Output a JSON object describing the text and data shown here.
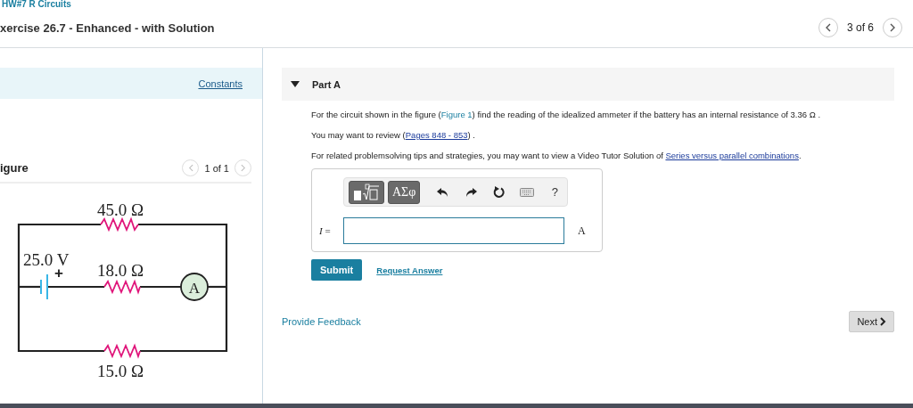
{
  "breadcrumb": "HW#7 R Circuits",
  "title": "xercise 26.7 - Enhanced - with Solution",
  "pager": "3 of 6",
  "constants_link": "Constants",
  "figure": {
    "heading": "igure",
    "pager": "1 of 1",
    "circuit": {
      "top_resistor": "45.0 Ω",
      "battery": "25.0 V",
      "battery_sign": "+",
      "middle_resistor": "18.0 Ω",
      "meter": "A",
      "bottom_resistor": "15.0 Ω"
    }
  },
  "part": {
    "title": "Part A",
    "expanded": true,
    "paragraphs": [
      [
        {
          "kind": "text",
          "text": "For the circuit shown in the figure ("
        },
        {
          "kind": "ref",
          "text": "Figure 1"
        },
        {
          "kind": "text",
          "text": ") find the reading of the idealized ammeter if the battery has an internal resistance of 3.36 Ω ."
        }
      ],
      [
        {
          "kind": "text",
          "text": "You may want to review ("
        },
        {
          "kind": "link",
          "text": "Pages 848 - 853"
        },
        {
          "kind": "text",
          "text": ") ."
        }
      ],
      [
        {
          "kind": "text",
          "text": "For related problemsolving tips and strategies, you may want to view a Video Tutor Solution of "
        },
        {
          "kind": "link",
          "text": "Series versus parallel combinations"
        },
        {
          "kind": "text",
          "text": "."
        }
      ]
    ],
    "toolbar": [
      {
        "kind": "templates"
      },
      {
        "kind": "symbols",
        "text": "ΑΣφ"
      },
      {
        "kind": "undo"
      },
      {
        "kind": "redo"
      },
      {
        "kind": "reset"
      },
      {
        "kind": "keyboard"
      },
      {
        "kind": "help",
        "text": "?"
      }
    ],
    "answer": {
      "label": "*I* =",
      "unit": "A"
    },
    "submit": "Submit",
    "request": "Request Answer"
  },
  "feedback": "Provide Feedback",
  "next": "Next"
}
